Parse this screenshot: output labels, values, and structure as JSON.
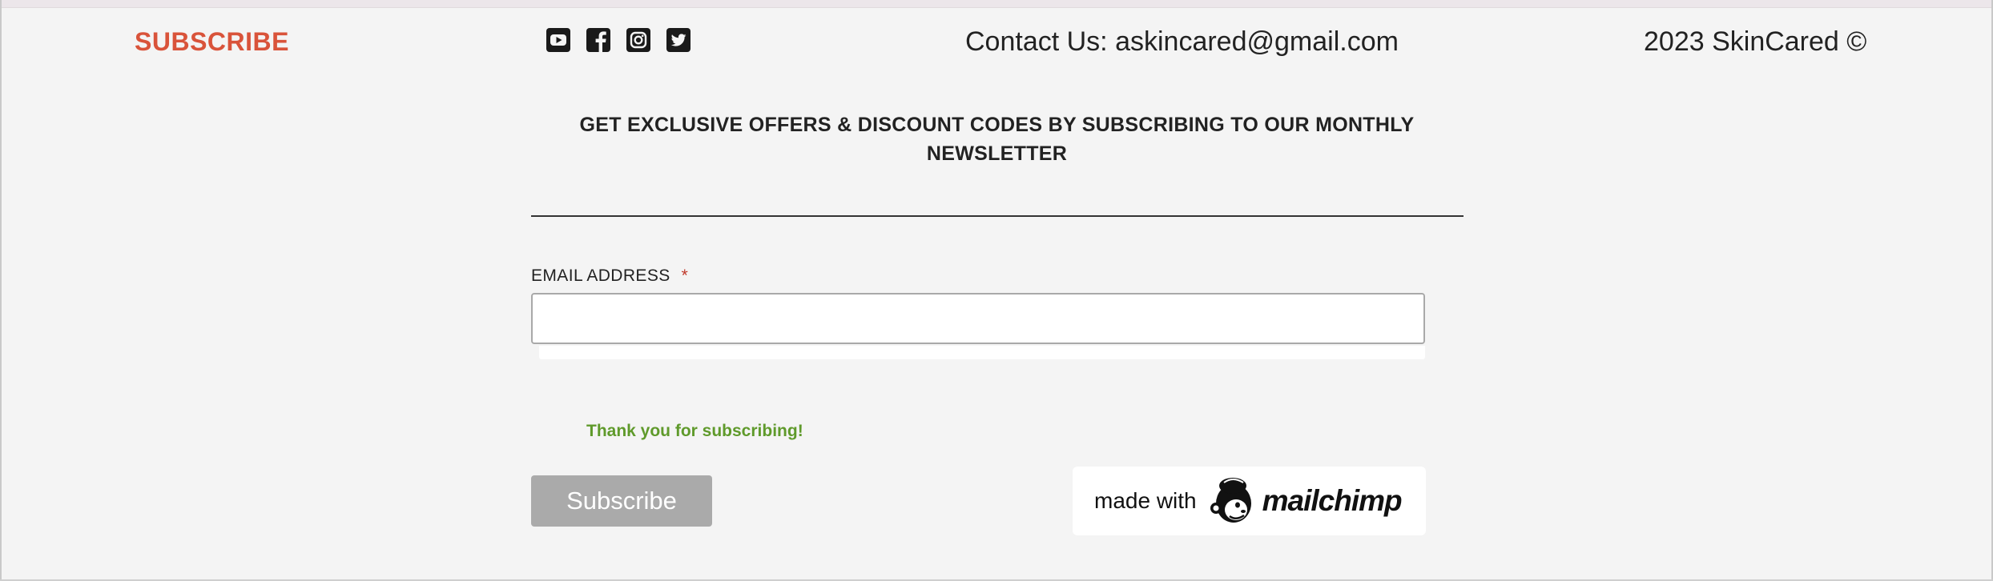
{
  "footer": {
    "subscribe_link": "SUBSCRIBE",
    "social": [
      "youtube-icon",
      "facebook-icon",
      "instagram-icon",
      "twitter-icon"
    ],
    "contact": "Contact Us: askincared@gmail.com",
    "copyright": "2023 SkinCared ©"
  },
  "newsletter": {
    "headline_line1": "GET EXCLUSIVE OFFERS & DISCOUNT CODES BY SUBSCRIBING TO OUR MONTHLY",
    "headline_line2": "NEWSLETTER",
    "email_label": "EMAIL ADDRESS",
    "required_marker": "*",
    "email_value": "",
    "success_message": "Thank you for subscribing!",
    "submit_label": "Subscribe"
  },
  "mailchimp_badge": {
    "made_with": "made with",
    "brand": "mailchimp"
  },
  "colors": {
    "background": "#f4f4f4",
    "accent": "#d9533a",
    "success": "#5f9a2b",
    "button": "#aaaaaa"
  }
}
